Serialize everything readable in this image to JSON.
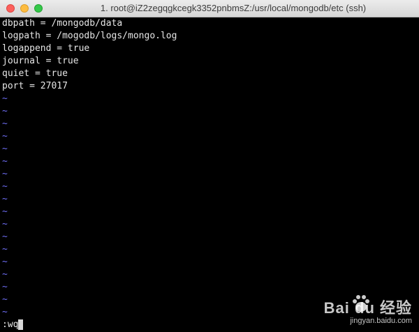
{
  "window": {
    "title": "1. root@iZ2zegqgkcegk3352pnbmsZ:/usr/local/mongodb/etc (ssh)"
  },
  "editor": {
    "lines": [
      "dbpath = /mongodb/data",
      "logpath = /mogodb/logs/mongo.log",
      "logappend = true",
      "journal = true",
      "quiet = true",
      "port = 27017"
    ],
    "empty_marker": "~",
    "command_line": ":wq"
  },
  "watermark": {
    "brand": "Bai du 经验",
    "url": "jingyan.baidu.com"
  },
  "colors": {
    "background": "#000000",
    "text": "#e6e6e6",
    "tilde": "#6e6ef5"
  }
}
